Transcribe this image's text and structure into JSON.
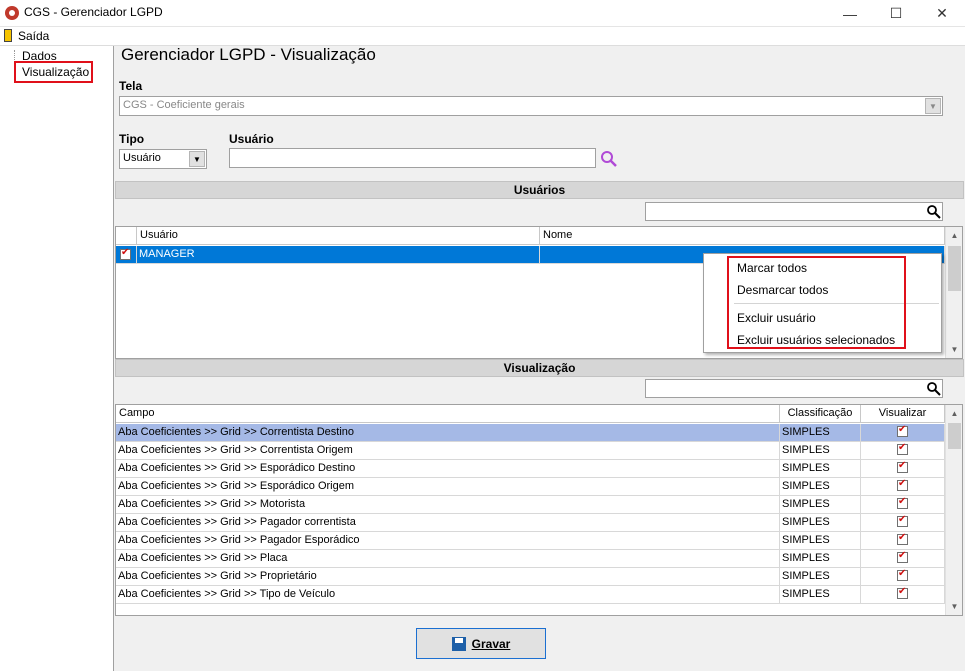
{
  "window": {
    "title": "CGS - Gerenciador LGPD",
    "minimize": "—",
    "maximize": "☐",
    "close": "✕"
  },
  "menu": {
    "exit_label": "Saída"
  },
  "tree": {
    "items": [
      "Dados",
      "Visualização"
    ]
  },
  "page": {
    "title": "Gerenciador LGPD - Visualização"
  },
  "tela": {
    "label": "Tela",
    "value": "CGS - Coeficiente gerais"
  },
  "tipo": {
    "label": "Tipo",
    "value": "Usuário"
  },
  "usuario_field": {
    "label": "Usuário",
    "value": ""
  },
  "usuarios_section": {
    "title": "Usuários",
    "columns": [
      "Usuário",
      "Nome"
    ],
    "rows": [
      {
        "checked": true,
        "usuario": "MANAGER",
        "nome": ""
      }
    ]
  },
  "context_menu": {
    "items": [
      "Marcar todos",
      "Desmarcar todos",
      "Excluir usuário",
      "Excluir usuários selecionados"
    ]
  },
  "visualizacao_section": {
    "title": "Visualização",
    "columns": [
      "Campo",
      "Classificação",
      "Visualizar"
    ],
    "rows": [
      {
        "campo": "Aba Coeficientes >> Grid >> Correntista Destino",
        "classificacao": "SIMPLES",
        "visualizar": true
      },
      {
        "campo": "Aba Coeficientes >> Grid >> Correntista Origem",
        "classificacao": "SIMPLES",
        "visualizar": true
      },
      {
        "campo": "Aba Coeficientes >> Grid >> Esporádico Destino",
        "classificacao": "SIMPLES",
        "visualizar": true
      },
      {
        "campo": "Aba Coeficientes >> Grid >> Esporádico Origem",
        "classificacao": "SIMPLES",
        "visualizar": true
      },
      {
        "campo": "Aba Coeficientes >> Grid >> Motorista",
        "classificacao": "SIMPLES",
        "visualizar": true
      },
      {
        "campo": "Aba Coeficientes >> Grid >> Pagador correntista",
        "classificacao": "SIMPLES",
        "visualizar": true
      },
      {
        "campo": "Aba Coeficientes >> Grid >> Pagador Esporádico",
        "classificacao": "SIMPLES",
        "visualizar": true
      },
      {
        "campo": "Aba Coeficientes >> Grid >> Placa",
        "classificacao": "SIMPLES",
        "visualizar": true
      },
      {
        "campo": "Aba Coeficientes >> Grid >> Proprietário",
        "classificacao": "SIMPLES",
        "visualizar": true
      },
      {
        "campo": "Aba Coeficientes >> Grid >> Tipo de Veículo",
        "classificacao": "SIMPLES",
        "visualizar": true
      }
    ]
  },
  "save_button": {
    "label": "Gravar"
  },
  "colors": {
    "selected_row": "#0078d7",
    "highlight_row": "#a5b9e6",
    "annotation_red": "#e0101a"
  }
}
